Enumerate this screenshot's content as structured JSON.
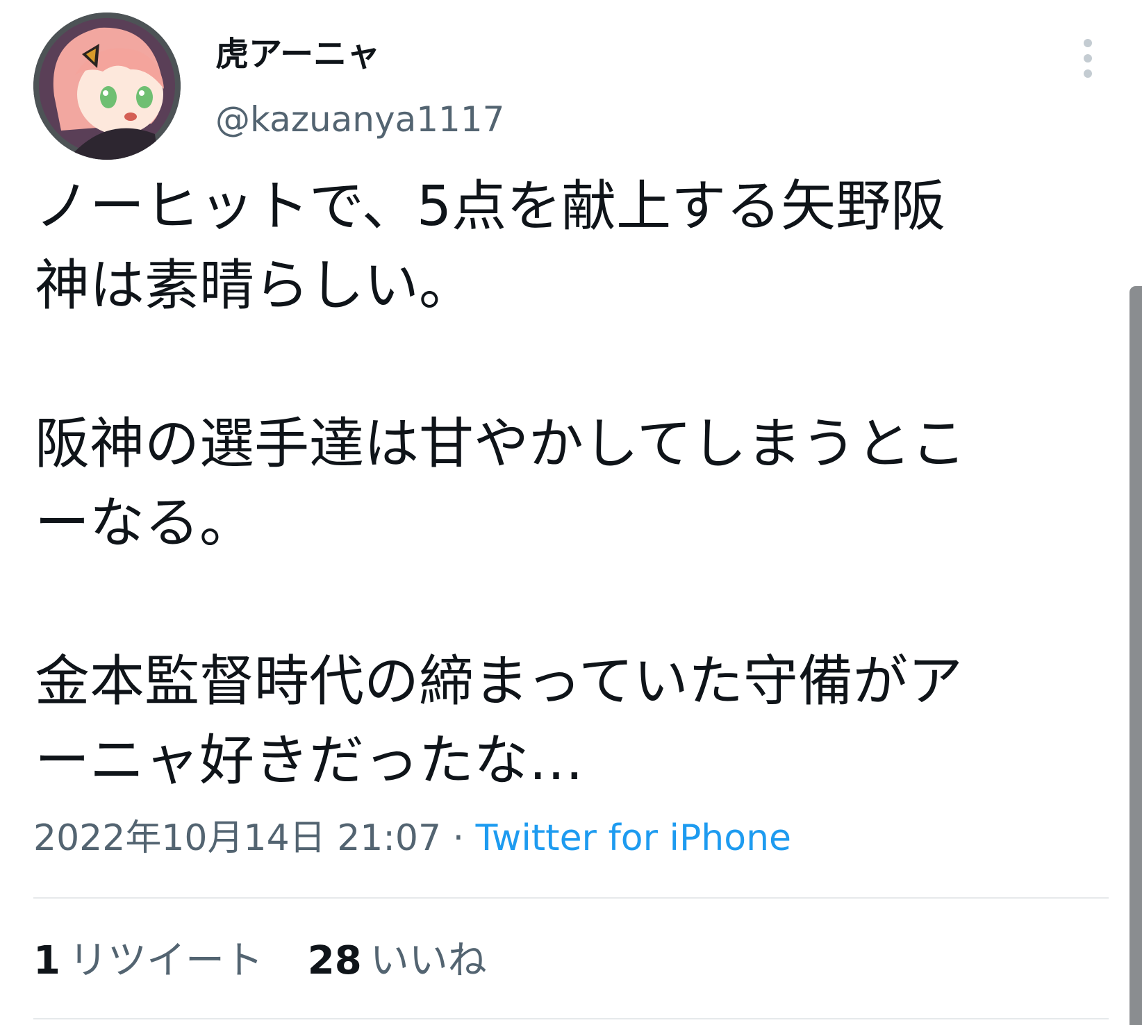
{
  "user": {
    "display_name": "虎アーニャ",
    "handle": "@kazuanya1117"
  },
  "tweet": {
    "lines": [
      "ノーヒットで、5点を献上する矢野阪",
      "神は素晴らしい。",
      "",
      "阪神の選手達は甘やかしてしまうとこ",
      "ーなる。",
      "",
      "金本監督時代の締まっていた守備がア",
      "ーニャ好きだったな…"
    ],
    "timestamp": "2022年10月14日 21:07",
    "separator": " · ",
    "source": "Twitter for iPhone"
  },
  "stats": {
    "retweets_count": "1",
    "retweets_label": "リツイート",
    "likes_count": "28",
    "likes_label": "いいね"
  },
  "icons": {
    "avatar": "avatar-image",
    "more": "more-options-icon"
  },
  "colors": {
    "link": "#1d9bf0",
    "secondary_text": "#536471",
    "primary_text": "#0f1419"
  }
}
